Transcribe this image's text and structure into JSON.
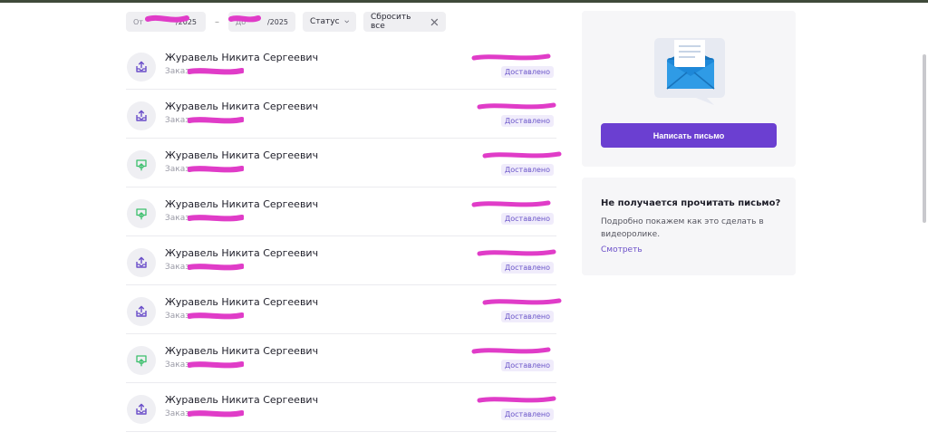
{
  "filters": {
    "from_label": "От",
    "from_value": "/2025",
    "to_label": "До",
    "to_value": "/2025",
    "status_label": "Статус",
    "reset_label": "Сбросить все"
  },
  "orders": [
    {
      "name": "Журавель Никита Сергеевич",
      "sub": "Заказ",
      "status": "Доставлено",
      "icon": "outbox-icon"
    },
    {
      "name": "Журавель Никита Сергеевич",
      "sub": "Заказ",
      "status": "Доставлено",
      "icon": "outbox-icon"
    },
    {
      "name": "Журавель Никита Сергеевич",
      "sub": "Заказ",
      "status": "Доставлено",
      "icon": "inbox-icon"
    },
    {
      "name": "Журавель Никита Сергеевич",
      "sub": "Заказ",
      "status": "Доставлено",
      "icon": "inbox-icon"
    },
    {
      "name": "Журавель Никита Сергеевич",
      "sub": "Заказ",
      "status": "Доставлено",
      "icon": "outbox-icon"
    },
    {
      "name": "Журавель Никита Сергеевич",
      "sub": "Заказ",
      "status": "Доставлено",
      "icon": "outbox-icon"
    },
    {
      "name": "Журавель Никита Сергеевич",
      "sub": "Заказ",
      "status": "Доставлено",
      "icon": "inbox-icon"
    },
    {
      "name": "Журавель Никита Сергеевич",
      "sub": "Заказ",
      "status": "Доставлено",
      "icon": "outbox-icon"
    }
  ],
  "compose": {
    "button_label": "Написать письмо"
  },
  "help": {
    "title": "Не получается прочитать письмо?",
    "text": "Подробно покажем как это сделать в видеоролике.",
    "link": "Смотреть"
  },
  "colors": {
    "accent": "#6b3fd1",
    "badge_bg": "#f0ecfb",
    "badge_text": "#6a55c9",
    "outbox_icon": "#6b4fc9",
    "inbox_icon": "#3bbf6c",
    "redaction": "#e03cc8"
  }
}
